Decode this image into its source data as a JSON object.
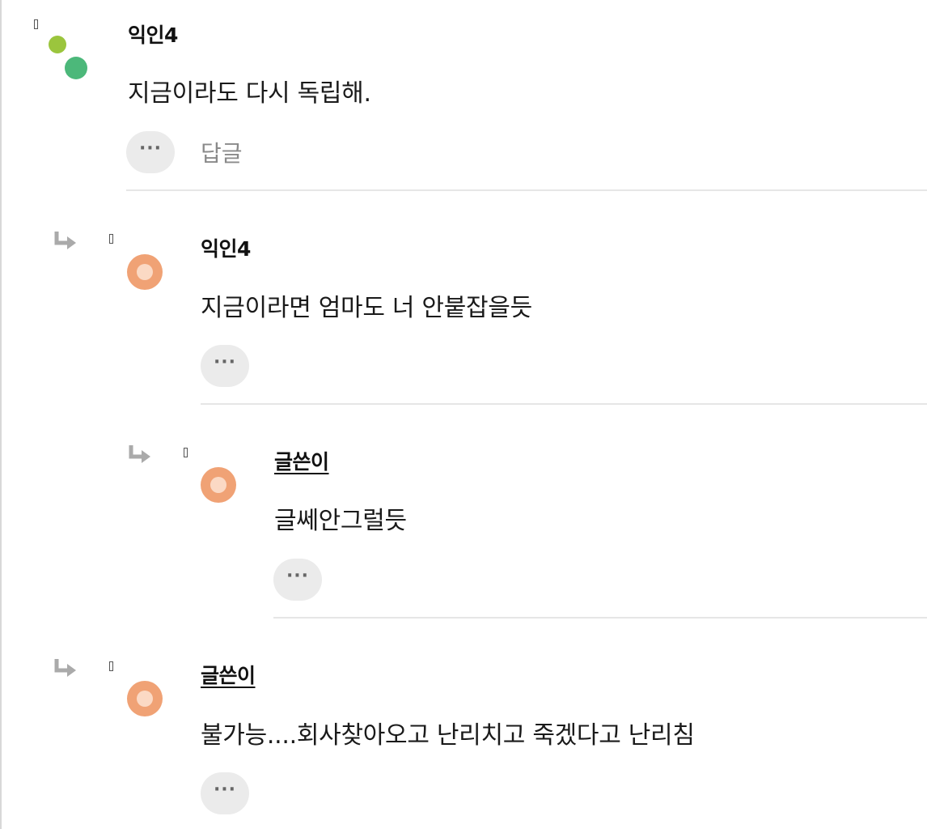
{
  "comments": [
    {
      "author": "익인4",
      "text": "지금이라도 다시 독립해.",
      "more_label": "···",
      "reply_label": "답글"
    },
    {
      "author": "익인4",
      "text": "지금이라면 엄마도 너 안붙잡을듯",
      "more_label": "···"
    },
    {
      "author": "글쓴이",
      "text": "글쎄안그럴듯",
      "more_label": "···"
    },
    {
      "author": "글쓴이",
      "text": "불가능....회사찾아오고 난리치고 죽겠다고 난리침",
      "more_label": "···"
    }
  ],
  "colors": {
    "avatar_green_light": "#9bc53d",
    "avatar_green_dark": "#4cb87a",
    "avatar_orange": "#f0a275",
    "more_button_bg": "#ebebeb",
    "reply_arrow": "#aaaaaa"
  },
  "icons": {
    "reply_arrow": "reply-arrow-icon",
    "comment_marker": "comment-marker-icon",
    "more": "more-dots-icon"
  }
}
